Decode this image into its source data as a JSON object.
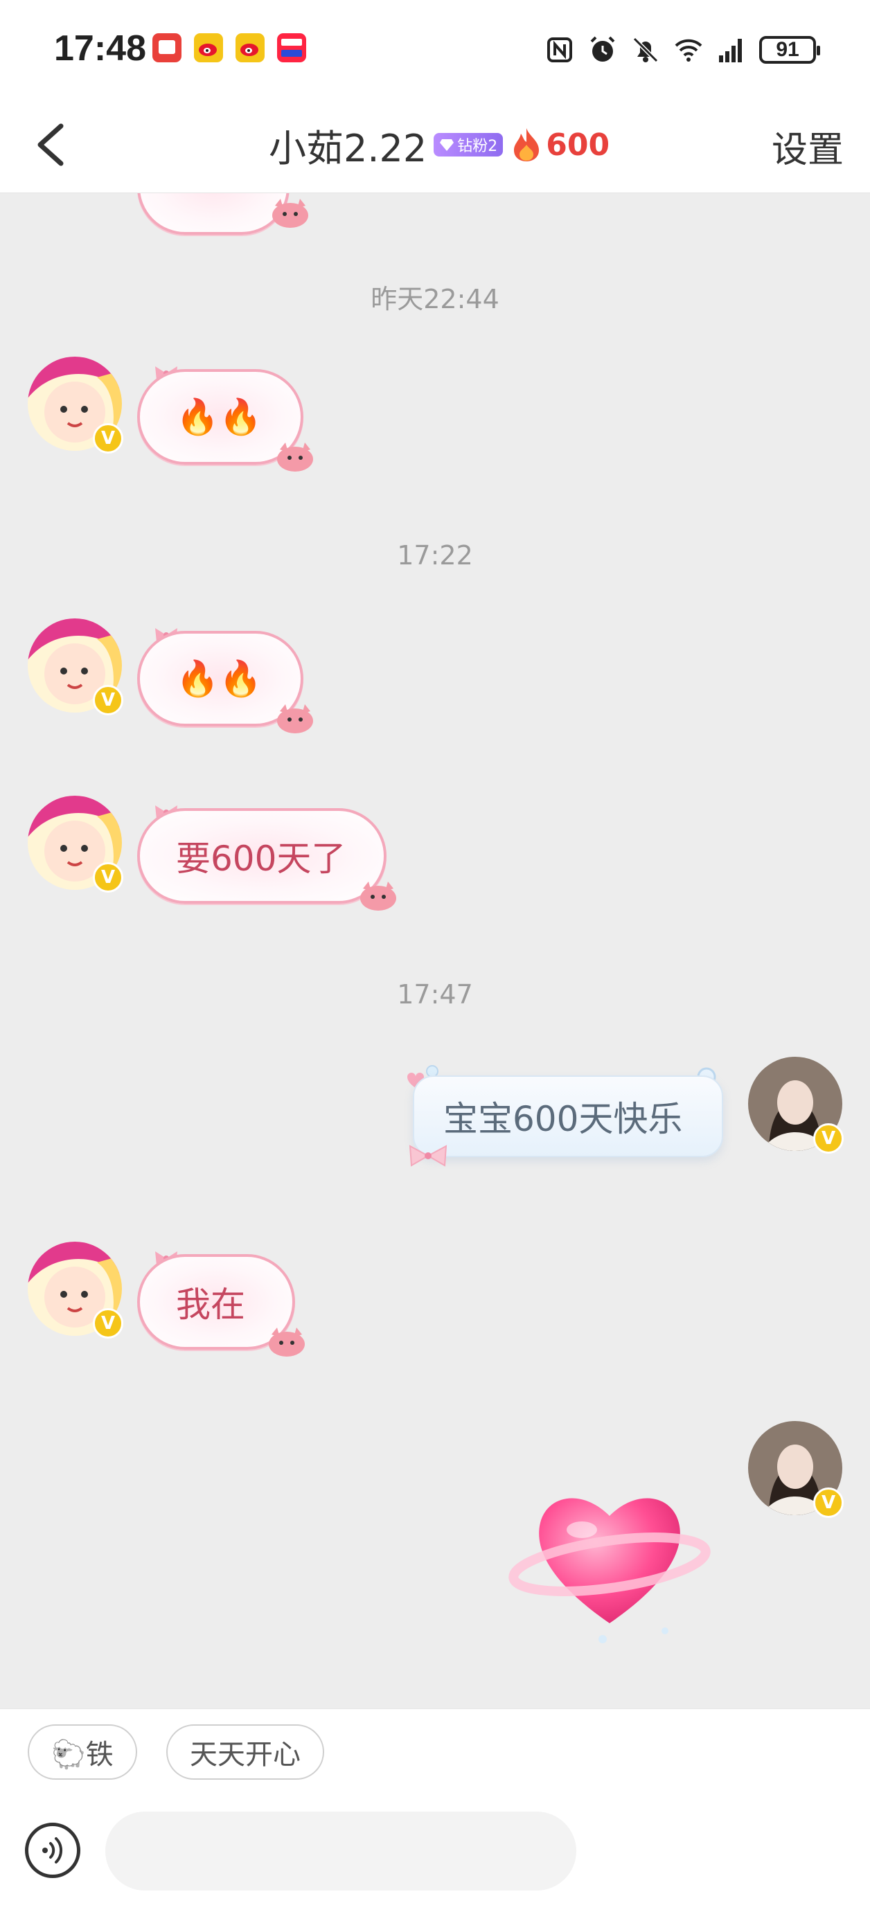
{
  "status_bar": {
    "time": "17:48",
    "battery": "91"
  },
  "header": {
    "title": "小茹2.22",
    "fan_badge": "钻粉2",
    "fire_count": "600",
    "settings": "设置"
  },
  "chat": {
    "messages": [
      {
        "timestamp": "昨天22:44"
      },
      {
        "from": "other",
        "text": "🔥🔥"
      },
      {
        "timestamp": "17:22"
      },
      {
        "from": "other",
        "text": "🔥🔥"
      },
      {
        "from": "other",
        "text": "要600天了"
      },
      {
        "timestamp": "17:47"
      },
      {
        "from": "me",
        "text": "宝宝600天快乐"
      },
      {
        "from": "other",
        "text": "我在"
      },
      {
        "from": "me",
        "sticker": "heart-sticker"
      }
    ]
  },
  "quick_replies": [
    {
      "text": "🐑铁"
    },
    {
      "text": "天天开心"
    }
  ],
  "input": {
    "placeholder": ""
  },
  "colors": {
    "accent_red": "#e8413c",
    "bubble_border": "#f4a8bb",
    "bubble_text": "#c5465f",
    "badge_purple": "#8f6cf0",
    "verified_yellow": "#f5c518"
  }
}
